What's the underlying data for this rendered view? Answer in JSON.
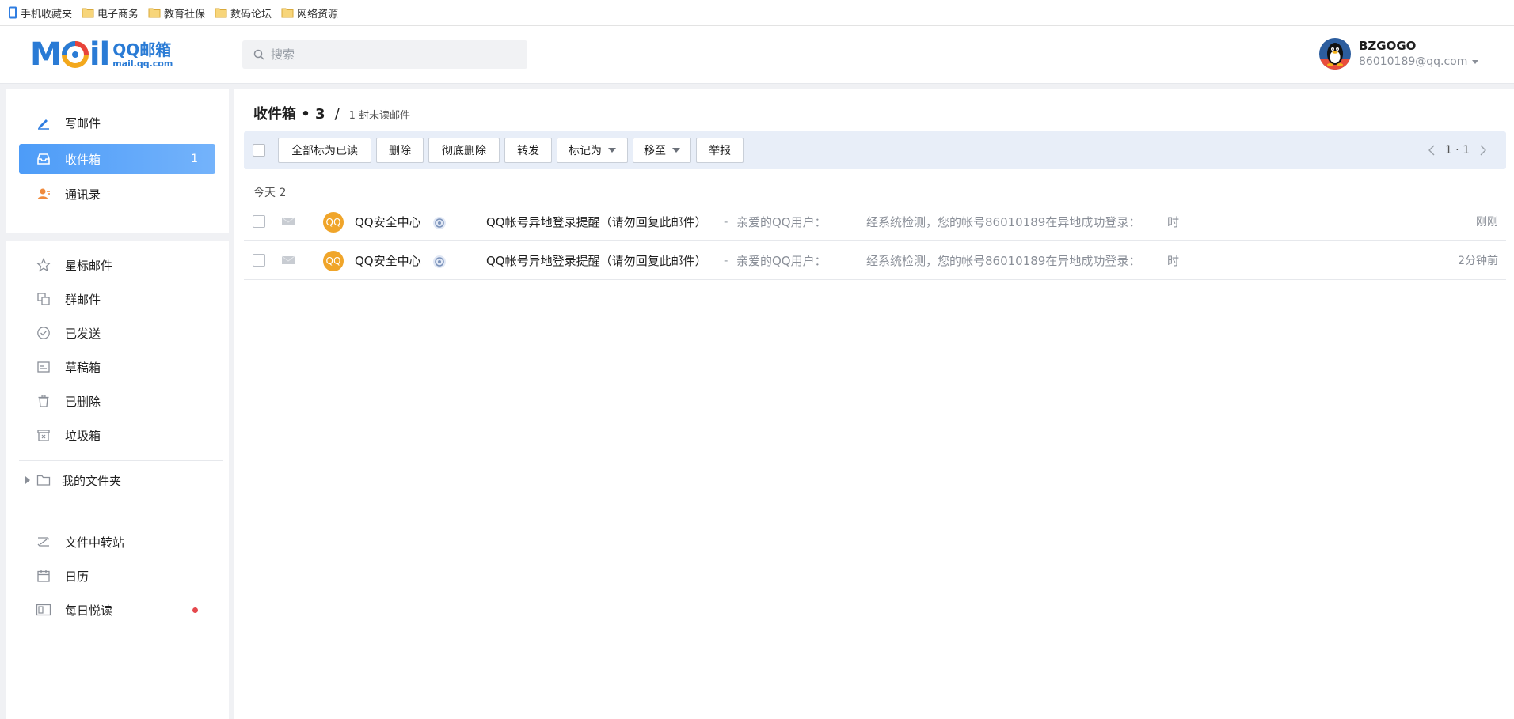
{
  "bookmarks": [
    {
      "label": "手机收藏夹",
      "icon": "phone-bookmark-icon"
    },
    {
      "label": "电子商务",
      "icon": "folder-icon"
    },
    {
      "label": "教育社保",
      "icon": "folder-icon"
    },
    {
      "label": "数码论坛",
      "icon": "folder-icon"
    },
    {
      "label": "网络资源",
      "icon": "folder-icon"
    }
  ],
  "header": {
    "logo_text": "M",
    "logo_text2": "il",
    "logo_qq": "QQ邮箱",
    "logo_url": "mail.qq.com",
    "search_placeholder": "搜索",
    "user_name": "BZGOGO",
    "user_email": "86010189@qq.com"
  },
  "sidebar": {
    "compose": "写邮件",
    "inbox": "收件箱",
    "inbox_count": "1",
    "contacts": "通讯录",
    "starred": "星标邮件",
    "group": "群邮件",
    "sent": "已发送",
    "drafts": "草稿箱",
    "deleted": "已删除",
    "spam": "垃圾箱",
    "my_folders": "我的文件夹",
    "file_transfer": "文件中转站",
    "calendar": "日历",
    "daily_reading": "每日悦读"
  },
  "main": {
    "title": "收件箱 • 3",
    "separator": "/",
    "unread_text": "1 封未读邮件",
    "toolbar": {
      "mark_all_read": "全部标为已读",
      "delete": "删除",
      "delete_permanently": "彻底删除",
      "forward": "转发",
      "mark_as": "标记为",
      "move_to": "移至",
      "report": "举报"
    },
    "pager_text": "1 · 1",
    "group_label": "今天 2",
    "emails": [
      {
        "avatar_text": "QQ",
        "sender": "QQ安全中心",
        "subject": "QQ帐号异地登录提醒（请勿回复此邮件）",
        "dash": "-",
        "preview_part1": "亲爱的QQ用户：",
        "preview_part2": "经系统检测，您的帐号86010189在异地成功登录：",
        "preview_part3": "时",
        "time": "刚刚"
      },
      {
        "avatar_text": "QQ",
        "sender": "QQ安全中心",
        "subject": "QQ帐号异地登录提醒（请勿回复此邮件）",
        "dash": "-",
        "preview_part1": "亲爱的QQ用户：",
        "preview_part2": "经系统检测，您的帐号86010189在异地成功登录：",
        "preview_part3": "时",
        "time": "2分钟前"
      }
    ]
  },
  "colors": {
    "accent": "#4d9cf8",
    "qq_badge": "#f0a52a",
    "toolbar_bg": "#e8eef8",
    "notification_dot": "#e5484d"
  }
}
